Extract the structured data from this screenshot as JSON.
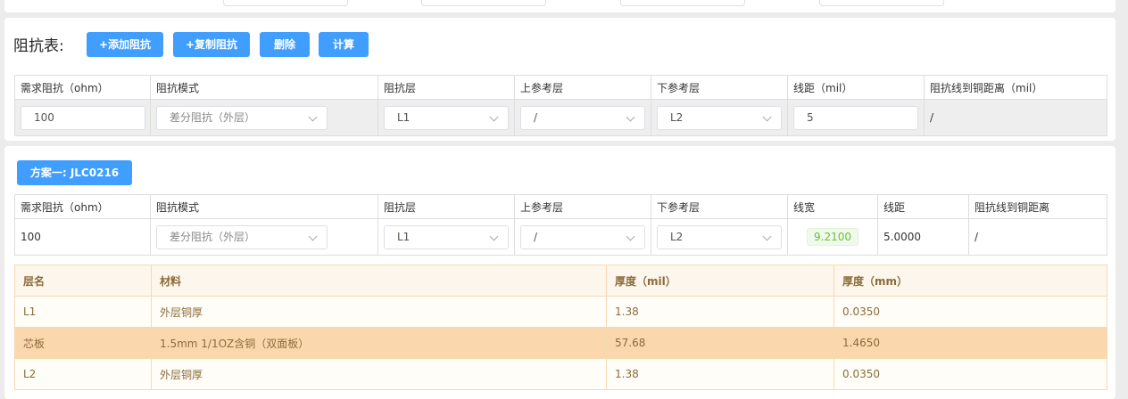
{
  "impedance_table": {
    "title": "阻抗表:",
    "buttons": {
      "add": "+添加阻抗",
      "copy": "+复制阻抗",
      "delete": "删除",
      "calc": "计算"
    },
    "headers": [
      "需求阻抗（ohm）",
      "阻抗模式",
      "阻抗层",
      "上参考层",
      "下参考层",
      "线距（mil）",
      "阻抗线到铜距离（mil）"
    ],
    "row": {
      "demand": "100",
      "mode": "差分阻抗（外层）",
      "layer": "L1",
      "upper_ref": "/",
      "lower_ref": "L2",
      "spacing": "5",
      "copper_dist": "/"
    }
  },
  "scheme": {
    "tab_label": "方案一: JLC0216",
    "headers": [
      "需求阻抗（ohm）",
      "阻抗模式",
      "阻抗层",
      "上参考层",
      "下参考层",
      "线宽",
      "线距",
      "阻抗线到铜距离"
    ],
    "row": {
      "demand": "100",
      "mode": "差分阻抗（外层）",
      "layer": "L1",
      "upper_ref": "/",
      "lower_ref": "L2",
      "width": "9.2100",
      "spacing": "5.0000",
      "copper_dist": "/"
    }
  },
  "layers": {
    "headers": [
      "层名",
      "材料",
      "厚度（mil）",
      "厚度（mm）"
    ],
    "rows": [
      {
        "name": "L1",
        "material": "外层铜厚",
        "mil": "1.38",
        "mm": "0.0350"
      },
      {
        "name": "芯板",
        "material": "1.5mm 1/1OZ含铜（双面板）",
        "mil": "57.68",
        "mm": "1.4650"
      },
      {
        "name": "L2",
        "material": "外层铜厚",
        "mil": "1.38",
        "mm": "0.0350"
      }
    ]
  },
  "colors": {
    "primary": "#409eff",
    "success": "#67c23a",
    "highlight_row": "#fbd7ae",
    "warning_border": "#f5dab1"
  }
}
